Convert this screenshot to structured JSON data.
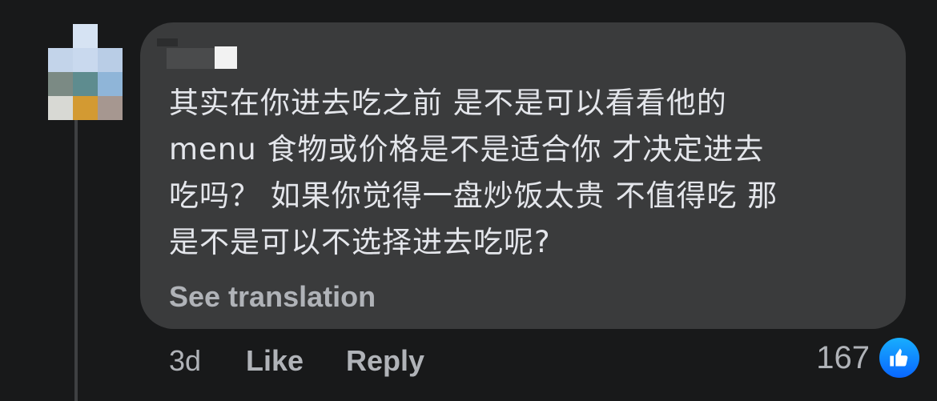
{
  "comment": {
    "lines": [
      "其实在你进去吃之前 是不是可以看看他的",
      "menu 食物或价格是不是适合你 才决定进去",
      "吃吗？ 如果你觉得一盘炒饭太贵 不值得吃 那",
      "是不是可以不选择进去吃呢?"
    ],
    "see_translation": "See translation",
    "time": "3d",
    "like_label": "Like",
    "reply_label": "Reply",
    "reaction_count": "167",
    "reaction_icon": "like-thumbs-up-icon"
  },
  "colors": {
    "background": "#18191a",
    "bubble": "#3a3b3c",
    "text": "#e4e6eb",
    "secondary_text": "#b0b3b8",
    "like_blue": "#0866ff"
  }
}
